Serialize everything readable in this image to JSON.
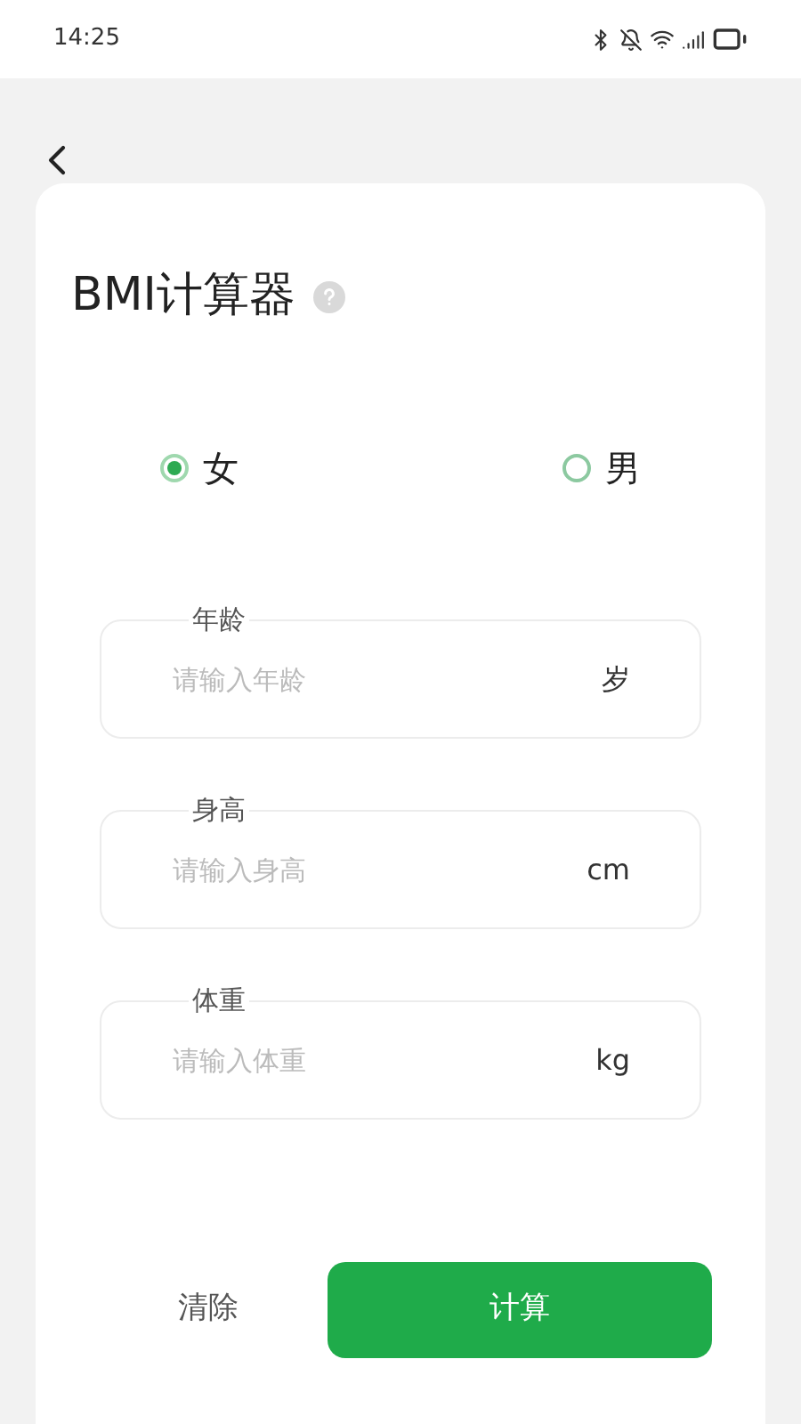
{
  "status_bar": {
    "time": "14:25"
  },
  "title": "BMI计算器",
  "gender": [
    {
      "label": "女",
      "selected": true
    },
    {
      "label": "男",
      "selected": false
    }
  ],
  "fields": [
    {
      "label": "年龄",
      "placeholder": "请输入年龄",
      "unit": "岁"
    },
    {
      "label": "身高",
      "placeholder": "请输入身高",
      "unit": "cm"
    },
    {
      "label": "体重",
      "placeholder": "请输入体重",
      "unit": "kg"
    }
  ],
  "buttons": {
    "clear": "清除",
    "calculate": "计算"
  }
}
